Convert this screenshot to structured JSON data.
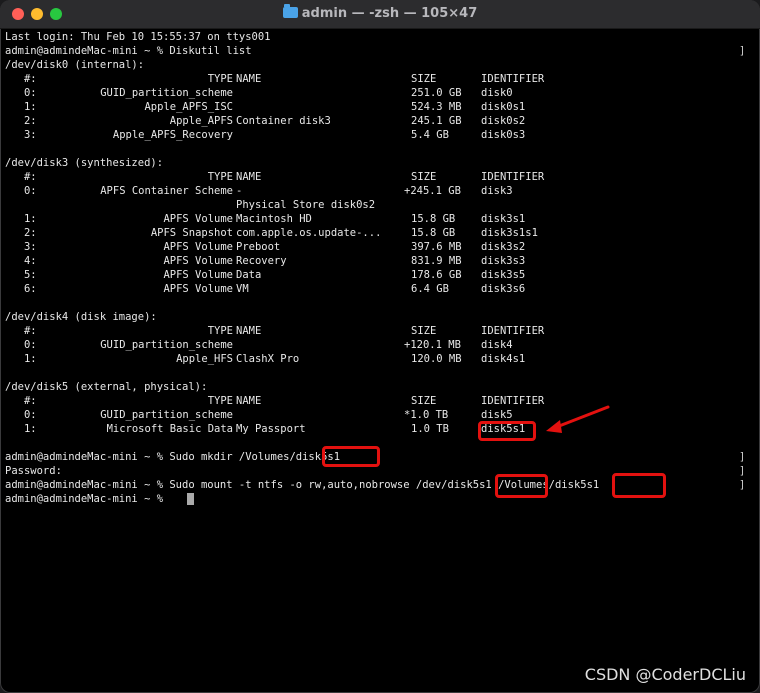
{
  "window": {
    "title": "admin — -zsh — 105×47",
    "icons": [
      "close",
      "minimize",
      "zoom",
      "folder-icon"
    ]
  },
  "terminal": {
    "lines": [
      {
        "c": [
          [
            "",
            "Last login: Thu Feb 10 15:55:37 on ttys001"
          ]
        ]
      },
      {
        "mark": true,
        "c": [
          [
            "",
            "admin@admindeMac-mini ~ % Diskutil list"
          ]
        ]
      },
      {
        "c": [
          [
            "",
            "/dev/disk0 (internal):"
          ]
        ]
      },
      {
        "c": [
          [
            "",
            "   #:"
          ],
          [
            "type",
            "TYPE"
          ],
          [
            "name",
            "NAME"
          ],
          [
            "size",
            "SIZE"
          ],
          [
            "id",
            "IDENTIFIER"
          ]
        ]
      },
      {
        "c": [
          [
            "",
            "   0:"
          ],
          [
            "type",
            "GUID_partition_scheme"
          ],
          [
            "name",
            ""
          ],
          [
            "size",
            "251.0 GB"
          ],
          [
            "id",
            "disk0"
          ]
        ]
      },
      {
        "c": [
          [
            "",
            "   1:"
          ],
          [
            "type",
            "Apple_APFS_ISC"
          ],
          [
            "name",
            ""
          ],
          [
            "size",
            "524.3 MB"
          ],
          [
            "id",
            "disk0s1"
          ]
        ]
      },
      {
        "c": [
          [
            "",
            "   2:"
          ],
          [
            "type",
            "Apple_APFS"
          ],
          [
            "name",
            "Container disk3"
          ],
          [
            "size",
            "245.1 GB"
          ],
          [
            "id",
            "disk0s2"
          ]
        ]
      },
      {
        "c": [
          [
            "",
            "   3:"
          ],
          [
            "type",
            "Apple_APFS_Recovery"
          ],
          [
            "name",
            ""
          ],
          [
            "size",
            "5.4 GB"
          ],
          [
            "id",
            "disk0s3"
          ]
        ]
      },
      {
        "c": []
      },
      {
        "c": [
          [
            "",
            "/dev/disk3 (synthesized):"
          ]
        ]
      },
      {
        "c": [
          [
            "",
            "   #:"
          ],
          [
            "type",
            "TYPE"
          ],
          [
            "name",
            "NAME"
          ],
          [
            "size",
            "SIZE"
          ],
          [
            "id",
            "IDENTIFIER"
          ]
        ]
      },
      {
        "c": [
          [
            "",
            "   0:"
          ],
          [
            "type",
            "APFS Container Scheme"
          ],
          [
            "name",
            "-"
          ],
          [
            "size",
            "+245.1 GB"
          ],
          [
            "id",
            "disk3"
          ]
        ]
      },
      {
        "c": [
          [
            "name",
            "Physical Store disk0s2"
          ]
        ]
      },
      {
        "c": [
          [
            "",
            "   1:"
          ],
          [
            "type",
            "APFS Volume"
          ],
          [
            "name",
            "Macintosh HD"
          ],
          [
            "size",
            "15.8 GB"
          ],
          [
            "id",
            "disk3s1"
          ]
        ]
      },
      {
        "c": [
          [
            "",
            "   2:"
          ],
          [
            "type",
            "APFS Snapshot"
          ],
          [
            "name",
            "com.apple.os.update-..."
          ],
          [
            "size",
            "15.8 GB"
          ],
          [
            "id",
            "disk3s1s1"
          ]
        ]
      },
      {
        "c": [
          [
            "",
            "   3:"
          ],
          [
            "type",
            "APFS Volume"
          ],
          [
            "name",
            "Preboot"
          ],
          [
            "size",
            "397.6 MB"
          ],
          [
            "id",
            "disk3s2"
          ]
        ]
      },
      {
        "c": [
          [
            "",
            "   4:"
          ],
          [
            "type",
            "APFS Volume"
          ],
          [
            "name",
            "Recovery"
          ],
          [
            "size",
            "831.9 MB"
          ],
          [
            "id",
            "disk3s3"
          ]
        ]
      },
      {
        "c": [
          [
            "",
            "   5:"
          ],
          [
            "type",
            "APFS Volume"
          ],
          [
            "name",
            "Data"
          ],
          [
            "size",
            "178.6 GB"
          ],
          [
            "id",
            "disk3s5"
          ]
        ]
      },
      {
        "c": [
          [
            "",
            "   6:"
          ],
          [
            "type",
            "APFS Volume"
          ],
          [
            "name",
            "VM"
          ],
          [
            "size",
            "6.4 GB"
          ],
          [
            "id",
            "disk3s6"
          ]
        ]
      },
      {
        "c": []
      },
      {
        "c": [
          [
            "",
            "/dev/disk4 (disk image):"
          ]
        ]
      },
      {
        "c": [
          [
            "",
            "   #:"
          ],
          [
            "type",
            "TYPE"
          ],
          [
            "name",
            "NAME"
          ],
          [
            "size",
            "SIZE"
          ],
          [
            "id",
            "IDENTIFIER"
          ]
        ]
      },
      {
        "c": [
          [
            "",
            "   0:"
          ],
          [
            "type",
            "GUID_partition_scheme"
          ],
          [
            "name",
            ""
          ],
          [
            "size",
            "+120.1 MB"
          ],
          [
            "id",
            "disk4"
          ]
        ]
      },
      {
        "c": [
          [
            "",
            "   1:"
          ],
          [
            "type",
            "Apple_HFS"
          ],
          [
            "name",
            "ClashX Pro"
          ],
          [
            "size",
            "120.0 MB"
          ],
          [
            "id",
            "disk4s1"
          ]
        ]
      },
      {
        "c": []
      },
      {
        "c": [
          [
            "",
            "/dev/disk5 (external, physical):"
          ]
        ]
      },
      {
        "c": [
          [
            "",
            "   #:"
          ],
          [
            "type",
            "TYPE"
          ],
          [
            "name",
            "NAME"
          ],
          [
            "size",
            "SIZE"
          ],
          [
            "id",
            "IDENTIFIER"
          ]
        ]
      },
      {
        "c": [
          [
            "",
            "   0:"
          ],
          [
            "type",
            "GUID_partition_scheme"
          ],
          [
            "name",
            ""
          ],
          [
            "size",
            "*1.0 TB"
          ],
          [
            "id",
            "disk5"
          ]
        ]
      },
      {
        "c": [
          [
            "",
            "   1:"
          ],
          [
            "type",
            "Microsoft Basic Data"
          ],
          [
            "name",
            "My Passport"
          ],
          [
            "size",
            "1.0 TB"
          ],
          [
            "id",
            "disk5s1"
          ]
        ]
      },
      {
        "c": []
      },
      {
        "mark": true,
        "c": [
          [
            "",
            "admin@admindeMac-mini ~ % Sudo mkdir /Volumes/disk5s1"
          ]
        ]
      },
      {
        "mark": true,
        "c": [
          [
            "",
            "Password:"
          ]
        ]
      },
      {
        "mark": true,
        "c": [
          [
            "",
            "admin@admindeMac-mini ~ % Sudo mount -t ntfs -o rw,auto,nobrowse /dev/disk5s1 /Volumes/disk5s1"
          ]
        ]
      },
      {
        "c": [
          [
            "",
            "admin@admindeMac-mini ~ % "
          ]
        ]
      }
    ]
  },
  "watermark": "CSDN @CoderDCLiu",
  "colors": {
    "highlight": "#e3110f",
    "text": "#e8e8e8",
    "background": "#000000"
  }
}
